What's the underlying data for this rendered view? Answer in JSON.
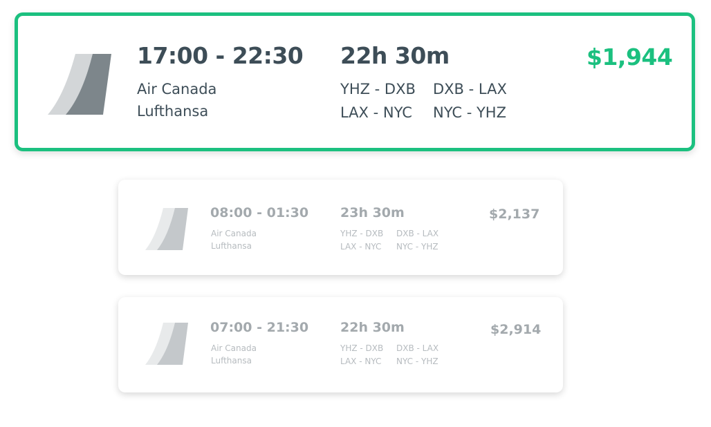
{
  "flights": [
    {
      "time": "17:00 - 22:30",
      "duration": "22h 30m",
      "price": "$1,944",
      "airlines": [
        "Air Canada",
        "Lufthansa"
      ],
      "routes": [
        "YHZ - DXB",
        "DXB - LAX",
        "LAX - NYC",
        "NYC - YHZ"
      ],
      "selected": true,
      "logo_icon": "airline-tail-logo-icon"
    },
    {
      "time": "08:00 - 01:30",
      "duration": "23h 30m",
      "price": "$2,137",
      "airlines": [
        "Air Canada",
        "Lufthansa"
      ],
      "routes": [
        "YHZ - DXB",
        "DXB - LAX",
        "LAX - NYC",
        "NYC - YHZ"
      ],
      "selected": false,
      "logo_icon": "airline-tail-logo-icon"
    },
    {
      "time": "07:00 - 21:30",
      "duration": "22h 30m",
      "price": "$2,914",
      "airlines": [
        "Air Canada",
        "Lufthansa"
      ],
      "routes": [
        "YHZ - DXB",
        "DXB - LAX",
        "LAX - NYC",
        "NYC - YHZ"
      ],
      "selected": false,
      "logo_icon": "airline-tail-logo-icon"
    }
  ],
  "colors": {
    "accent": "#1bc07f",
    "text_primary": "#3d4d57",
    "text_muted": "#a3a9ad"
  }
}
